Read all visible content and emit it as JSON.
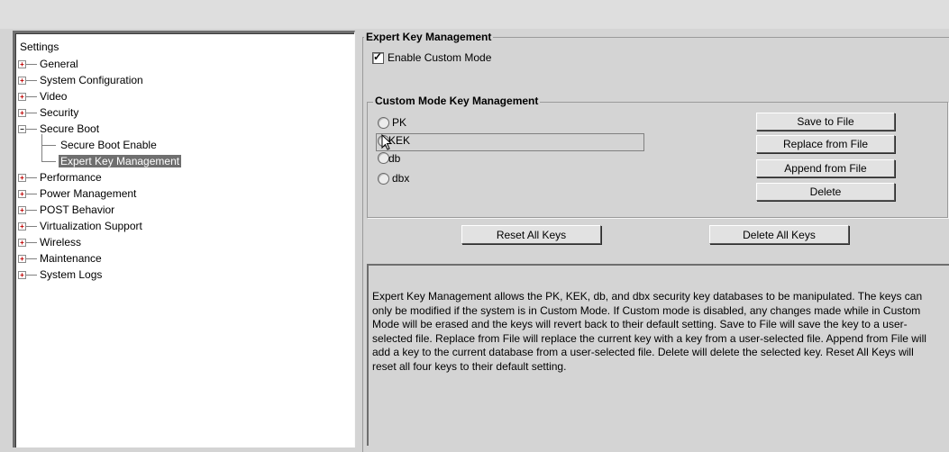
{
  "tree": {
    "root": "Settings",
    "items": [
      {
        "label": "General"
      },
      {
        "label": "System Configuration"
      },
      {
        "label": "Video"
      },
      {
        "label": "Security"
      },
      {
        "label": "Secure Boot",
        "expanded": true,
        "children": [
          {
            "label": "Secure Boot Enable"
          },
          {
            "label": "Expert Key Management",
            "selected": true
          }
        ]
      },
      {
        "label": "Performance"
      },
      {
        "label": "Power Management"
      },
      {
        "label": "POST Behavior"
      },
      {
        "label": "Virtualization Support"
      },
      {
        "label": "Wireless"
      },
      {
        "label": "Maintenance"
      },
      {
        "label": "System Logs"
      }
    ]
  },
  "expert": {
    "title": "Expert Key Management",
    "enable_label": "Enable Custom Mode",
    "enable_checked": true
  },
  "custom": {
    "title": "Custom Mode Key Management",
    "keys": [
      "PK",
      "KEK",
      "db",
      "dbx"
    ],
    "buttons": {
      "save": "Save to File",
      "replace": "Replace from File",
      "append": "Append from File",
      "delete": "Delete"
    }
  },
  "actions": {
    "reset_all": "Reset All Keys",
    "delete_all": "Delete All Keys"
  },
  "description": "Expert Key Management allows the PK, KEK, db, and dbx security key databases to be manipulated. The keys can only be modified if the system is in Custom Mode. If Custom mode is disabled, any changes made while in Custom Mode will be erased and the keys will revert back to their default setting. Save to File will save the key to a user-selected file. Replace from File will replace the current key with a key from a user-selected file. Append from File will add a key to the current database from a user-selected file. Delete will delete the selected key. Reset All Keys will reset all four keys to their default setting."
}
